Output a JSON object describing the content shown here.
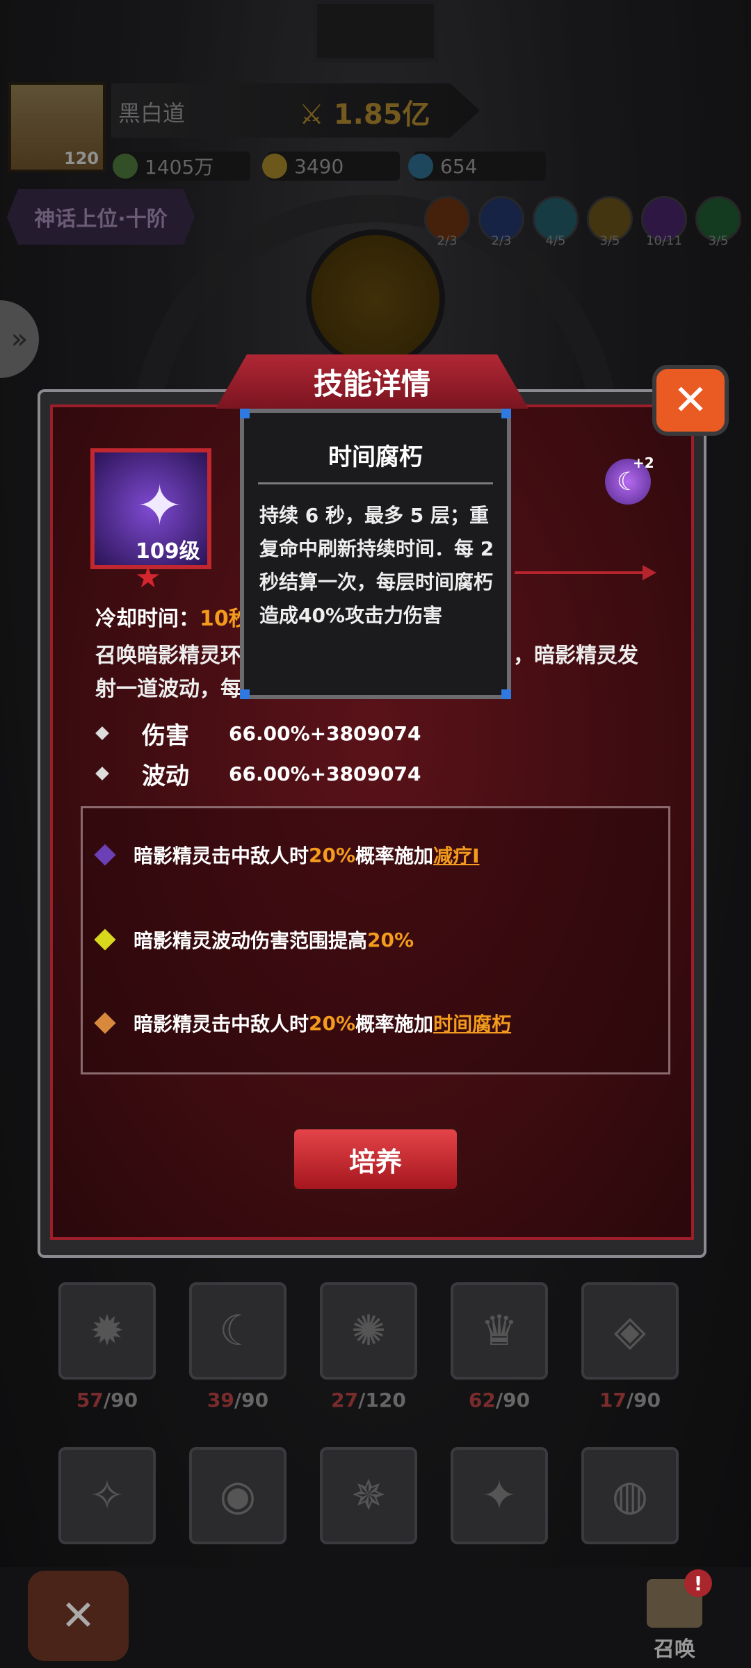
{
  "header": {
    "player_name": "黑白道",
    "power": "1.85亿",
    "avatar_level": "120",
    "resources": [
      {
        "icon": "green-coin-icon",
        "value": "1405万"
      },
      {
        "icon": "gold-coin-icon",
        "value": "3490"
      },
      {
        "icon": "blue-gem-icon",
        "value": "654"
      }
    ],
    "rank": "神话上位·十阶",
    "elements": [
      {
        "icon": "fire-element-icon",
        "count": "2/3",
        "color": "#b8541b"
      },
      {
        "icon": "wind-element-icon",
        "count": "2/3",
        "color": "#3557a8"
      },
      {
        "icon": "ice-element-icon",
        "count": "4/5",
        "color": "#3f9bb0"
      },
      {
        "icon": "light-element-icon",
        "count": "3/5",
        "color": "#b08d1d"
      },
      {
        "icon": "dark-element-icon",
        "count": "10/11",
        "color": "#7a3db0"
      },
      {
        "icon": "nature-element-icon",
        "count": "3/5",
        "color": "#2f9a4b"
      }
    ]
  },
  "modal": {
    "title": "技能详情",
    "skill_level": "109级",
    "moon_badge": "+2",
    "cooldown_label": "冷却时间：",
    "cooldown_value": "10秒",
    "desc_line1": "召唤暗影精灵环",
    "desc_line1_end": "，暗影精灵发",
    "desc_line2": "射一道波动，每",
    "stats": [
      {
        "label": "伤害",
        "value": "66.00%+3809074"
      },
      {
        "label": "波动",
        "value": "66.00%+3809074"
      }
    ],
    "upgrades": [
      {
        "pre": "暗影精灵击中敌人时",
        "hl": "20%",
        "mid": "概率施加",
        "link": "减疗I",
        "post": "",
        "color": "#6b3fb5"
      },
      {
        "pre": "暗影精灵波动伤害范围提高",
        "hl": "20%",
        "mid": "",
        "link": "",
        "post": "",
        "color": "#d8d81c"
      },
      {
        "pre": "暗影精灵击中敌人时",
        "hl": "20%",
        "mid": "概率施加",
        "link": "时间腐朽",
        "post": "",
        "color": "#d8893c"
      }
    ],
    "train_button": "培养"
  },
  "tooltip": {
    "title": "时间腐朽",
    "body": "持续 6 秒，最多 5 层；重复命中刷新持续时间．每 2 秒结算一次，每层时间腐朽造成40%攻击力伤害"
  },
  "slots_row1": [
    {
      "icon": "fire-burst-icon",
      "current": "57",
      "max": "/90"
    },
    {
      "icon": "shadow-claw-icon",
      "current": "39",
      "max": "/90"
    },
    {
      "icon": "flame-runner-icon",
      "current": "27",
      "max": "/120"
    },
    {
      "icon": "ice-crown-icon",
      "current": "62",
      "max": "/90"
    },
    {
      "icon": "gold-shield-icon",
      "current": "17",
      "max": "/90"
    }
  ],
  "slots_row2": [
    {
      "icon": "dark-wizard-icon"
    },
    {
      "icon": "eye-icon"
    },
    {
      "icon": "phoenix-icon"
    },
    {
      "icon": "purple-star-icon"
    },
    {
      "icon": "void-orb-icon"
    }
  ],
  "bottom": {
    "summon_label": "召唤",
    "alert": "!"
  }
}
